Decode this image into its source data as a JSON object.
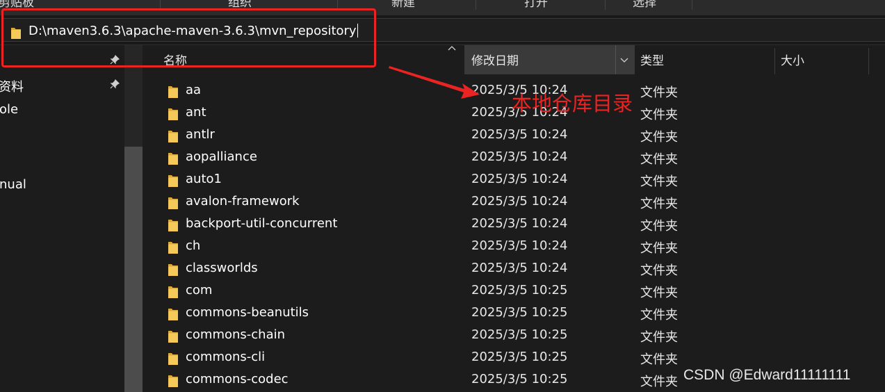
{
  "ribbon": {
    "groups": [
      "剪贴板",
      "组织",
      "新建",
      "打开",
      "选择"
    ]
  },
  "address_bar": {
    "path": "D:\\maven3.6.3\\apache-maven-3.6.3\\mvn_repository"
  },
  "nav": {
    "items": [
      "资料",
      "ole",
      "nual"
    ]
  },
  "columns": {
    "name": "名称",
    "date": "修改日期",
    "type": "类型",
    "size": "大小"
  },
  "files": [
    {
      "name": "aa",
      "date": "2025/3/5 10:24",
      "type": "文件夹"
    },
    {
      "name": "ant",
      "date": "2025/3/5 10:24",
      "type": "文件夹"
    },
    {
      "name": "antlr",
      "date": "2025/3/5 10:24",
      "type": "文件夹"
    },
    {
      "name": "aopalliance",
      "date": "2025/3/5 10:24",
      "type": "文件夹"
    },
    {
      "name": "auto1",
      "date": "2025/3/5 10:24",
      "type": "文件夹"
    },
    {
      "name": "avalon-framework",
      "date": "2025/3/5 10:24",
      "type": "文件夹"
    },
    {
      "name": "backport-util-concurrent",
      "date": "2025/3/5 10:24",
      "type": "文件夹"
    },
    {
      "name": "ch",
      "date": "2025/3/5 10:24",
      "type": "文件夹"
    },
    {
      "name": "classworlds",
      "date": "2025/3/5 10:24",
      "type": "文件夹"
    },
    {
      "name": "com",
      "date": "2025/3/5 10:25",
      "type": "文件夹"
    },
    {
      "name": "commons-beanutils",
      "date": "2025/3/5 10:25",
      "type": "文件夹"
    },
    {
      "name": "commons-chain",
      "date": "2025/3/5 10:25",
      "type": "文件夹"
    },
    {
      "name": "commons-cli",
      "date": "2025/3/5 10:25",
      "type": "文件夹"
    },
    {
      "name": "commons-codec",
      "date": "2025/3/5 10:25",
      "type": "文件夹"
    }
  ],
  "annotation": {
    "text": "本地仓库目录",
    "color": "#ea2323"
  },
  "watermark": "CSDN @Edward11111111",
  "colors": {
    "folder": "#f4c95a",
    "folder_dark": "#d9a93c",
    "background": "#1c1c1c",
    "sort_header": "#3a3a3a"
  }
}
